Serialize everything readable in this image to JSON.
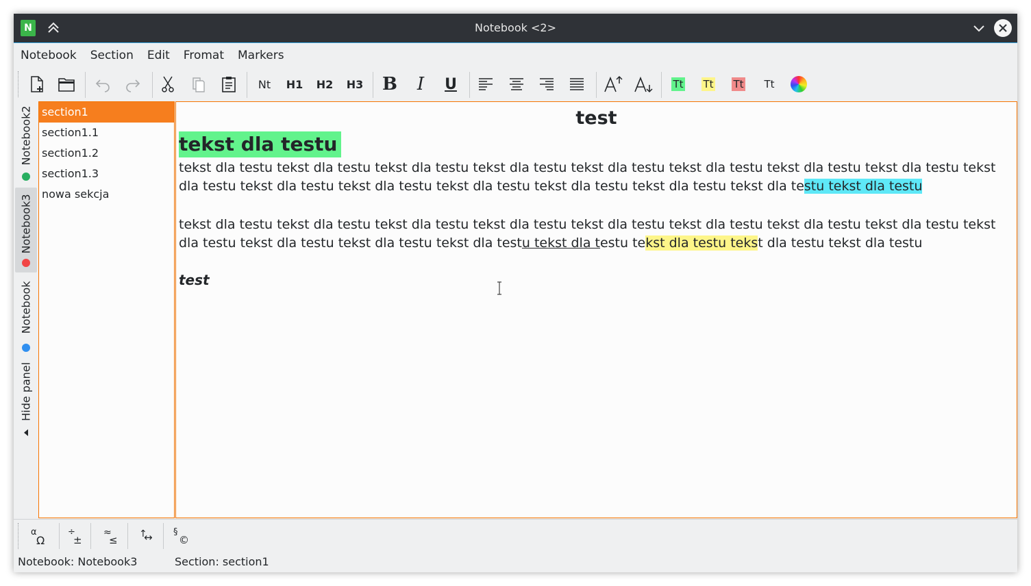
{
  "window": {
    "title": "Notebook <2>",
    "app_icon_letter": "N"
  },
  "menu": [
    "Notebook",
    "Section",
    "Edit",
    "Fromat",
    "Markers"
  ],
  "toolbar": {
    "style_labels": {
      "normal": "Nt",
      "h1": "H1",
      "h2": "H2",
      "h3": "H3"
    },
    "color_labels": {
      "green": "Tt",
      "yellow": "Tt",
      "red": "Tt",
      "clear": "Tt"
    },
    "colors": {
      "green": "#62f38c",
      "yellow": "#fdf589",
      "red": "#f08a8a"
    }
  },
  "notebooks": [
    {
      "label": "Notebook2",
      "dot_color": "#27ae60",
      "active": false
    },
    {
      "label": "Notebook3",
      "dot_color": "#f14444",
      "active": true
    },
    {
      "label": "Notebook",
      "dot_color": "#2f8ff0",
      "active": false
    }
  ],
  "hide_panel_label": "Hide panel",
  "sections": [
    "section1",
    "section1.1",
    "section1.2",
    "section1.3",
    "nowa sekcja"
  ],
  "selected_section": "section1",
  "document": {
    "title": "test",
    "heading": "tekst dla testu",
    "para1_plain": "tekst dla testu tekst dla testu tekst dla testu tekst dla testu tekst dla testu tekst dla testu tekst dla testu tekst dla testu tekst dla testu tekst dla testu tekst dla testu tekst dla testu tekst dla testu tekst dla testu tekst dla te",
    "para1_highlight": "stu tekst dla testu",
    "para2_part1": "tekst dla testu tekst dla testu tekst dla testu tekst dla testu tekst dla testu tekst dla testu tekst dla testu tekst dla testu tekst dla testu tekst dla testu tekst dla testu tekst dla test",
    "para2_underline": "u tekst dla t",
    "para2_part2": "estu te",
    "para2_highlight": "kst dla testu teks",
    "para2_part3": "t dla testu tekst dla testu",
    "italic_line": "test"
  },
  "bottom_tools": [
    {
      "top": "α",
      "bottom": "Ω"
    },
    {
      "top": "÷",
      "bottom": "±"
    },
    {
      "top": "≈",
      "bottom": "≤"
    },
    {
      "top": "↑",
      "bottom": "↔"
    },
    {
      "top": "§",
      "bottom": "©"
    }
  ],
  "status": {
    "notebook": "Notebook: Notebook3",
    "section": "Section: section1"
  },
  "accent": "#f67400"
}
